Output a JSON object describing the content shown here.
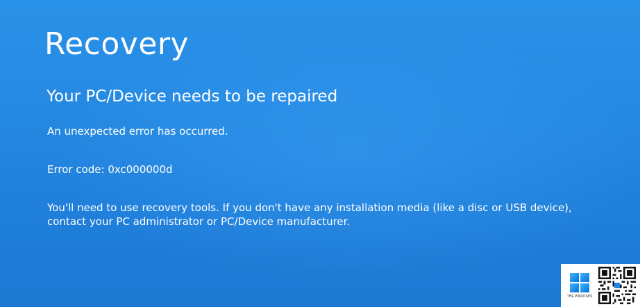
{
  "screen": {
    "title": "Recovery",
    "subtitle": "Your PC/Device needs to be repaired",
    "error_message": "An unexpected error has occurred.",
    "error_code_line": "Error code: 0xc000000d",
    "instructions": "You'll need to use recovery tools. If you don't have any installation media (like a disc or USB device), contact your PC administrator or PC/Device manufacturer."
  },
  "watermark": {
    "brand_text": "THE WINDOWS",
    "logo_icon": "windows-logo-icon",
    "qr_icon": "qr-code-icon"
  },
  "colors": {
    "background": "#2589e2",
    "text": "#ffffff"
  }
}
